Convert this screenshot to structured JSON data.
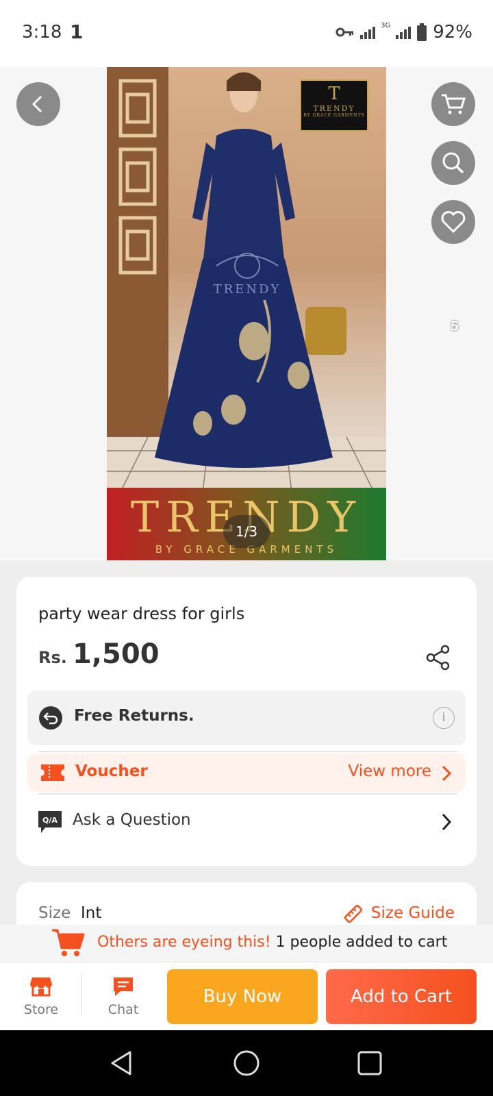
{
  "status": {
    "time": "3:18",
    "sim_indicator": "1",
    "network": "3G",
    "battery": "92%"
  },
  "gallery": {
    "counter": "1/3",
    "banner_title": "TRENDY",
    "banner_subtitle": "BY GRACE GARMENTS",
    "logo_text": "TRENDY",
    "logo_letter": "T",
    "logo_sub": "BY GRACE GARMENTS",
    "wishlist_count": "5"
  },
  "product": {
    "title": "party wear dress for girls",
    "currency": "Rs.",
    "price": "1,500",
    "returns_label": "Free Returns.",
    "info_symbol": "i",
    "voucher_label": "Voucher",
    "voucher_more": "View more",
    "ask_label": "Ask a Question"
  },
  "size": {
    "label": "Size",
    "value": "Int",
    "guide": "Size Guide"
  },
  "eyeing": {
    "text": "Others are eyeing this!",
    "count": "1 people added to cart"
  },
  "bottom": {
    "store_label": "Store",
    "chat_label": "Chat",
    "buy_now": "Buy Now",
    "add_to_cart": "Add to Cart"
  },
  "colors": {
    "accent": "#f4511e",
    "buy": "#fba61f"
  }
}
